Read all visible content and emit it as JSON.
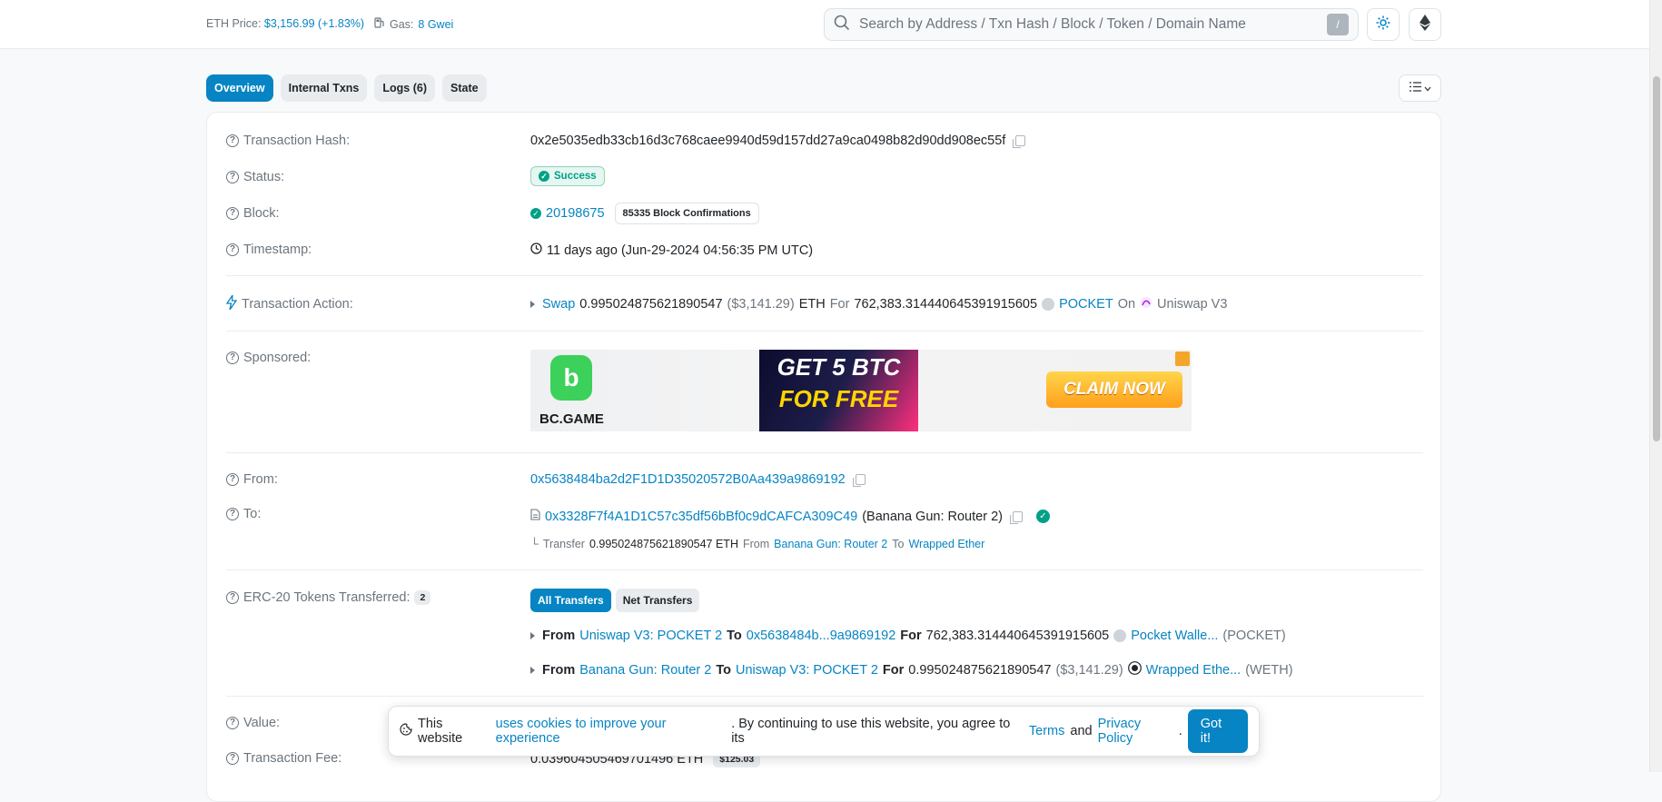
{
  "header": {
    "eth_price_label": "ETH Price:",
    "eth_price_value": "$3,156.99 (+1.83%)",
    "gas_label": "Gas:",
    "gas_value": "8 Gwei",
    "search_placeholder": "Search by Address / Txn Hash / Block / Token / Domain Name",
    "slash_key": "/",
    "icons": [
      "search-icon",
      "sun-icon",
      "ethereum-icon"
    ]
  },
  "tabs": [
    {
      "label": "Overview",
      "active": true
    },
    {
      "label": "Internal Txns",
      "active": false
    },
    {
      "label": "Logs (6)",
      "active": false
    },
    {
      "label": "State",
      "active": false
    }
  ],
  "overview": {
    "tx_hash_label": "Transaction Hash:",
    "tx_hash": "0x2e5035edb33cb16d3c768caee9940d59d157dd27a9ca0498b82d90dd908ec55f",
    "status_label": "Status:",
    "status": "Success",
    "block_label": "Block:",
    "block": "20198675",
    "confirmations": "85335 Block Confirmations",
    "timestamp_label": "Timestamp:",
    "timestamp": "11 days ago (Jun-29-2024 04:56:35 PM UTC)",
    "action_label": "Transaction Action:",
    "action": {
      "verb": "Swap",
      "amount": "0.995024875621890547",
      "usd": "($3,141.29)",
      "unit": "ETH",
      "for": "For",
      "token_amount": "762,383.314440645391915605",
      "token": "POCKET",
      "on": "On",
      "dex": "Uniswap V3"
    },
    "sponsored_label": "Sponsored:",
    "ad": {
      "brand": "BC.GAME",
      "line1": "GET 5 BTC",
      "line2": "FOR FREE",
      "cta": "CLAIM NOW"
    },
    "from_label": "From:",
    "from": "0x5638484ba2d2F1D1D35020572B0Aa439a9869192",
    "to_label": "To:",
    "to": "0x3328F7f4A1D1C57c35df56bBf0c9dCAFCA309C49",
    "to_name": "(Banana Gun: Router 2)",
    "internal_transfer": {
      "label": "Transfer",
      "amount": "0.995024875621890547 ETH",
      "from_word": "From",
      "from": "Banana Gun: Router 2",
      "to_word": "To",
      "to": "Wrapped Ether"
    },
    "erc20_label": "ERC-20 Tokens Transferred:",
    "erc20_count": "2",
    "erc20_tabs": [
      "All Transfers",
      "Net Transfers"
    ],
    "erc20_transfers": [
      {
        "from_word": "From",
        "from": "Uniswap V3: POCKET 2",
        "to_word": "To",
        "to": "0x5638484b...9a9869192",
        "for_word": "For",
        "amount": "762,383.314440645391915605",
        "usd": "",
        "token": "Pocket Walle...",
        "symbol": "(POCKET)"
      },
      {
        "from_word": "From",
        "from": "Banana Gun: Router 2",
        "to_word": "To",
        "to": "Uniswap V3: POCKET 2",
        "for_word": "For",
        "amount": "0.995024875621890547",
        "usd": "($3,141.29)",
        "token": "Wrapped Ethe...",
        "symbol": "(WETH)"
      }
    ],
    "value_label": "Value:",
    "fee_label": "Transaction Fee:",
    "fee": "0.039604505469701496 ETH",
    "fee_usd": "$125.03"
  },
  "cookie": {
    "text1": "This website",
    "link1": "uses cookies to improve your experience",
    "text2": ". By continuing to use this website, you agree to its",
    "terms": "Terms",
    "and": "and",
    "privacy": "Privacy Policy",
    "dot": ".",
    "button": "Got it!"
  },
  "colors": {
    "accent": "#0784c3",
    "success": "#00a186",
    "background": "#f8f9fa"
  }
}
